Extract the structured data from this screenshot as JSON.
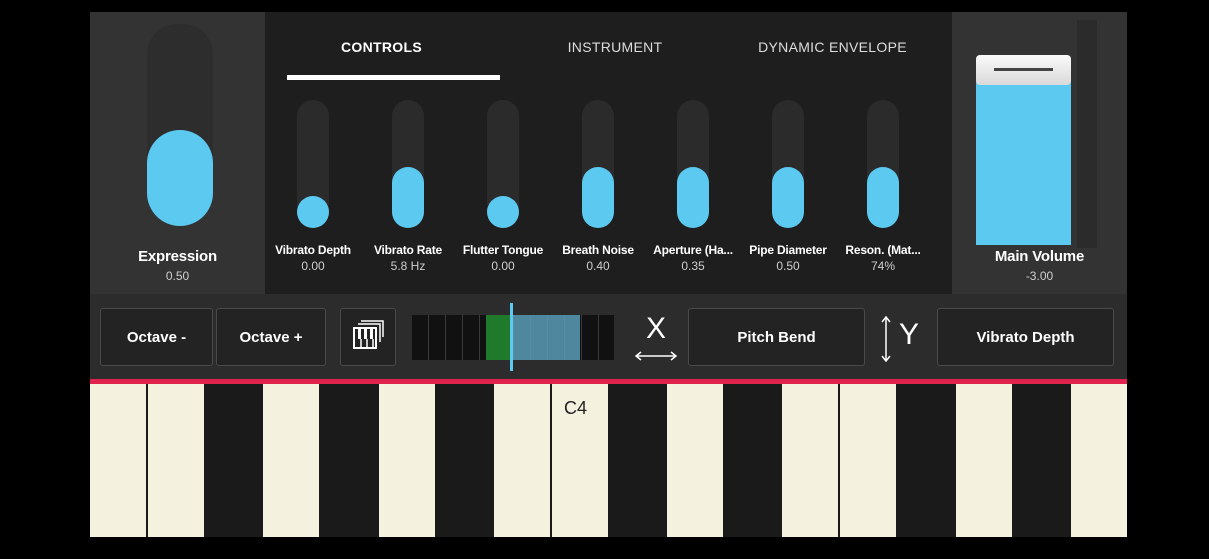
{
  "tabs": {
    "controls": "CONTROLS",
    "instrument": "INSTRUMENT",
    "dynamic_envelope": "DYNAMIC ENVELOPE"
  },
  "expression": {
    "label": "Expression",
    "value": "0.50",
    "level": 0.5
  },
  "sliders": [
    {
      "label": "Vibrato Depth",
      "value": "0.00",
      "level": 0.0
    },
    {
      "label": "Vibrato Rate",
      "value": "5.8 Hz",
      "level": 0.4
    },
    {
      "label": "Flutter Tongue",
      "value": "0.00",
      "level": 0.0
    },
    {
      "label": "Breath Noise",
      "value": "0.40",
      "level": 0.4
    },
    {
      "label": "Aperture (Ha...",
      "value": "0.35",
      "level": 0.35
    },
    {
      "label": "Pipe Diameter",
      "value": "0.50",
      "level": 0.4
    },
    {
      "label": "Reson. (Mat...",
      "value": "74%",
      "level": 0.4
    }
  ],
  "main_volume": {
    "label": "Main Volume",
    "value": "-3.00"
  },
  "toolbar": {
    "octave_down": "Octave -",
    "octave_up": "Octave +",
    "x_axis_label": "X",
    "pitch_bend": "Pitch Bend",
    "y_axis_label": "Y",
    "vibrato_depth": "Vibrato Depth"
  },
  "keyboard": {
    "key_label": "C4"
  },
  "colors": {
    "accent": "#5cc9f0",
    "red_line": "#e0234e",
    "key_white": "#f4f1df",
    "overview_green": "#1f7a2c"
  },
  "icons": [
    "piano-icon",
    "x-axis-icon",
    "y-axis-icon"
  ]
}
